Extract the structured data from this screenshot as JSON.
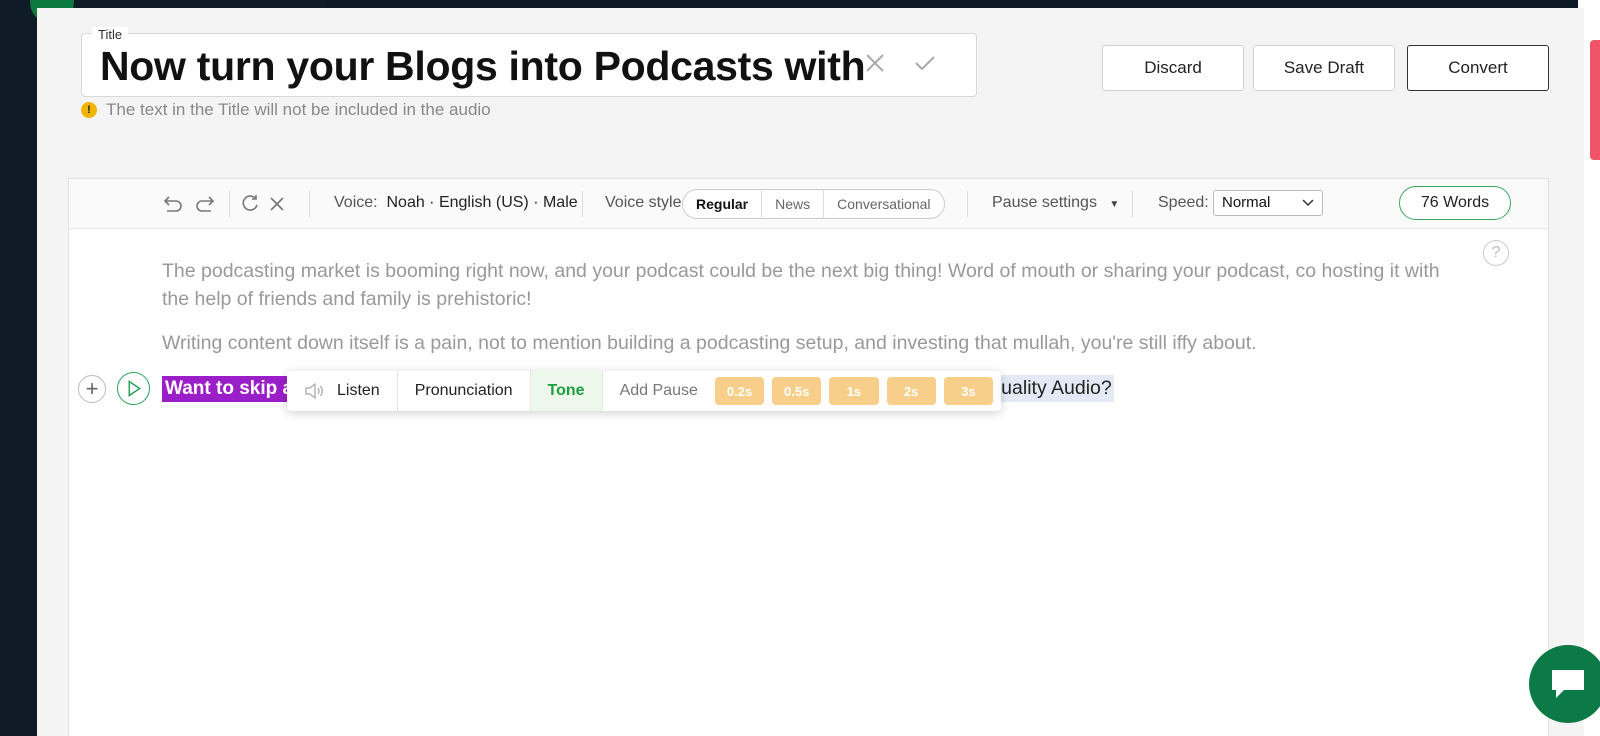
{
  "title": {
    "tag": "Title",
    "value": "Now turn your Blogs into Podcasts with",
    "note": "The text in the Title will not be included in the audio"
  },
  "actions": {
    "discard": "Discard",
    "save_draft": "Save Draft",
    "convert": "Convert"
  },
  "toolbar": {
    "voice_label": "Voice:",
    "voice_value": "Noah · English (US) · Male",
    "voice_style_label": "Voice style",
    "voice_styles": [
      "Regular",
      "News",
      "Conversational"
    ],
    "active_style": "Regular",
    "pause_settings": "Pause settings",
    "speed_label": "Speed:",
    "speed_value": "Normal",
    "word_count": "76 Words"
  },
  "content": {
    "paragraph1": "The podcasting market is booming right now, and your podcast could be the next big thing! Word of mouth or sharing your podcast, co hosting it with the help of friends and family is prehistoric!",
    "paragraph2": "Writing content down itself is a pain, not to mention building a podcasting setup, and investing that mullah, you're still iffy about.",
    "selected_fragment": "Want to skip a",
    "trailing_fragment": "Quality Audio?"
  },
  "popup": {
    "listen": "Listen",
    "pronunciation": "Pronunciation",
    "tone": "Tone",
    "add_pause": "Add Pause",
    "pauses": [
      "0.2s",
      "0.5s",
      "1s",
      "2s",
      "3s"
    ]
  },
  "help": "?",
  "colors": {
    "accent_green": "#2aa45a",
    "selection_purple": "#9b1fc9",
    "pause_pill": "#f7cf8a"
  }
}
